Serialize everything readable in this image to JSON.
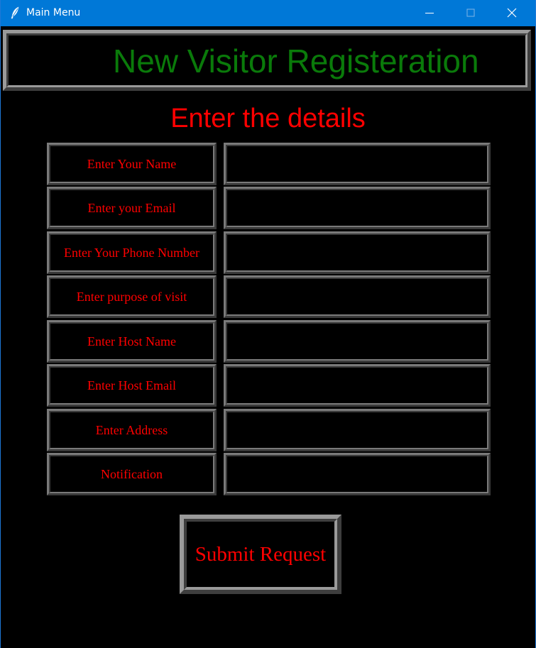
{
  "window": {
    "title": "Main Menu",
    "icon": "feather-icon",
    "controls": [
      "minimize-icon",
      "maximize-icon",
      "close-icon"
    ]
  },
  "header": {
    "title": "New Visitor Registeration"
  },
  "form": {
    "subtitle": "Enter the details",
    "fields": [
      {
        "label": "Enter Your Name",
        "value": ""
      },
      {
        "label": "Enter your Email",
        "value": ""
      },
      {
        "label": "Enter Your Phone Number",
        "value": ""
      },
      {
        "label": "Enter purpose of visit",
        "value": ""
      },
      {
        "label": "Enter Host Name",
        "value": ""
      },
      {
        "label": "Enter Host Email",
        "value": ""
      },
      {
        "label": "Enter Address",
        "value": ""
      },
      {
        "label": "Notification",
        "value": ""
      }
    ],
    "submit_label": "Submit Request"
  },
  "colors": {
    "titlebar": "#0078d7",
    "background": "#000000",
    "header_text": "#0a7a0a",
    "accent_text": "#ff0000",
    "border": "#7a7a7a"
  }
}
